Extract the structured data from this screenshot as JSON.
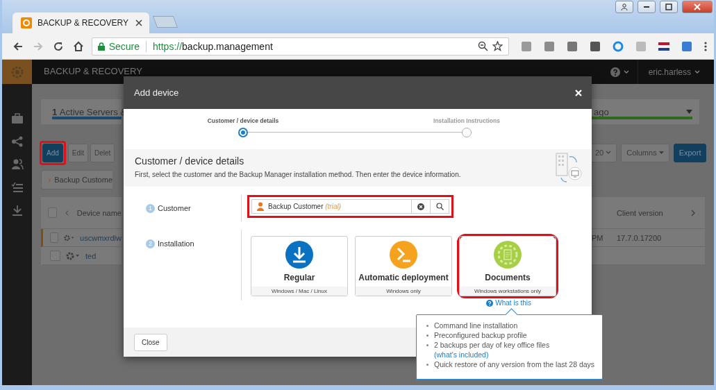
{
  "browser": {
    "tab_title": "BACKUP & RECOVERY",
    "secure_label": "Secure",
    "url_scheme": "https://",
    "url_host": "backup.management"
  },
  "app": {
    "title": "BACKUP & RECOVERY",
    "user": "eric.harless"
  },
  "background": {
    "tab_left": {
      "number": "1",
      "label": "Active Servers &"
    },
    "tab_right": "ago",
    "buttons": [
      {
        "label": "Add",
        "kind": "primary",
        "highlighted": true
      },
      {
        "label": "Edit",
        "kind": "plain",
        "highlighted": false
      },
      {
        "label": "Delet",
        "kind": "plain",
        "highlighted": false
      }
    ],
    "right_buttons": [
      {
        "label": "20",
        "kind": "dropdown"
      },
      {
        "label": "Columns",
        "kind": "menu"
      },
      {
        "label": "Export",
        "kind": "primary"
      }
    ],
    "filter_chip": "Backup Custome",
    "columns": {
      "device": "Device name",
      "client": "Client version"
    },
    "select_all_checked": false,
    "rows": [
      {
        "device": "uscwmxrdlw",
        "time": "PM",
        "version": "17.7.0.17200",
        "flagged": true,
        "checked": false
      },
      {
        "device": "ted",
        "flagged": false,
        "checked": false
      }
    ]
  },
  "modal": {
    "title": "Add device",
    "steps": [
      {
        "label": "Customer / device details",
        "selected": true
      },
      {
        "label": "Installation Instructions",
        "selected": false
      }
    ],
    "section_title": "Customer / device details",
    "section_description": "First, select the customer and the Backup Manager installation method. Then enter the device information.",
    "customer": {
      "number": "1",
      "label": "Customer",
      "value": "Backup Customer",
      "note": "(trial)",
      "highlighted": true
    },
    "installation": {
      "number": "2",
      "label": "Installation",
      "options": [
        {
          "title": "Regular",
          "subtitle": "Windows / Mac / Linux",
          "kind": "download",
          "highlighted": false
        },
        {
          "title": "Automatic deployment",
          "subtitle": "Windows only",
          "kind": "terminal",
          "highlighted": false
        },
        {
          "title": "Documents",
          "subtitle": "Windows workstations only",
          "kind": "documents",
          "highlighted": true
        }
      ]
    },
    "help_link": "What is this",
    "close_button": "Close"
  },
  "tooltip": {
    "items": [
      {
        "text": "Command line installation"
      },
      {
        "text": "Preconfigured backup profile"
      },
      {
        "text": "2 backups per day of key office files",
        "link": "(what's included)"
      },
      {
        "text": "Quick restore of any version from the last 28 days"
      }
    ]
  }
}
